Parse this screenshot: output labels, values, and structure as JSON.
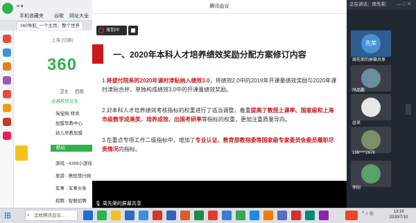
{
  "browser": {
    "address_hint": "手机收藏夹",
    "bookmarks": [
      "手机收藏夹",
      "谷歌",
      "网址大全"
    ],
    "tab_label": "360导航_一个主页，整个世界",
    "page_lines": [
      "上海 [切换]",
      "卫士",
      "日历",
      "淘宝网·特卖",
      "加盟早教中心",
      "幼儿早教加盟",
      "游戏 - 4399小游戏",
      "旅游 - 携程旅行网",
      "军事 - 军事头条",
      "招聘 - 智联招聘"
    ],
    "section_label": "酷站",
    "logo_text": "360",
    "wechat_hint": "@高校毕业生"
  },
  "meeting": {
    "window_title": "腾讯会议",
    "record_label": "录制中",
    "share_label": "周先荣的屏幕共享"
  },
  "slide": {
    "title": "一、2020年本科人才培养绩效奖励分配方案修订内容",
    "p1_pre": "1.",
    "p1_hl": "将拔付院系的2020年课时津贴纳入绩效3.0",
    "p1_rest": "，将绩效2.0中的2019年开课量绩效奖励与2020年课时津贴合并，单独构成绩效3.0中的开课量绩效奖励。",
    "p2_pre": "2.对本科人才培养绩效考核指标的权重进行了适当调整，着重",
    "p2_hl": "提高了教授上课率、国家级和上海市级教学成果奖、培养成效、出国考研率",
    "p2_rest": "等指标的权重，更加注重质量导向。",
    "p3_pre": "3.在重点专项工作二级指标中，增加了",
    "p3_hl": "专业认证、教育部教指委等国家级专家委员会委员履职尽责情况",
    "p3_rest": "的指标。"
  },
  "panel": {
    "title": "正在讲话：周先荣;",
    "participants": [
      {
        "name": "周先荣的屏幕共享",
        "avatar_text": "先荣"
      },
      {
        "name": "冯品鹏"
      },
      {
        "name": "@吴"
      },
      {
        "name": "138****2678"
      },
      {
        "name": "李阳"
      }
    ]
  },
  "taskbar": {
    "search_text": "怎样腾讯会议...",
    "time": "13:19",
    "date": "2020/7/10"
  },
  "colors": {
    "accent_red": "#c9191c",
    "brand_green": "#2fb24c",
    "panel_bg": "#222831"
  }
}
